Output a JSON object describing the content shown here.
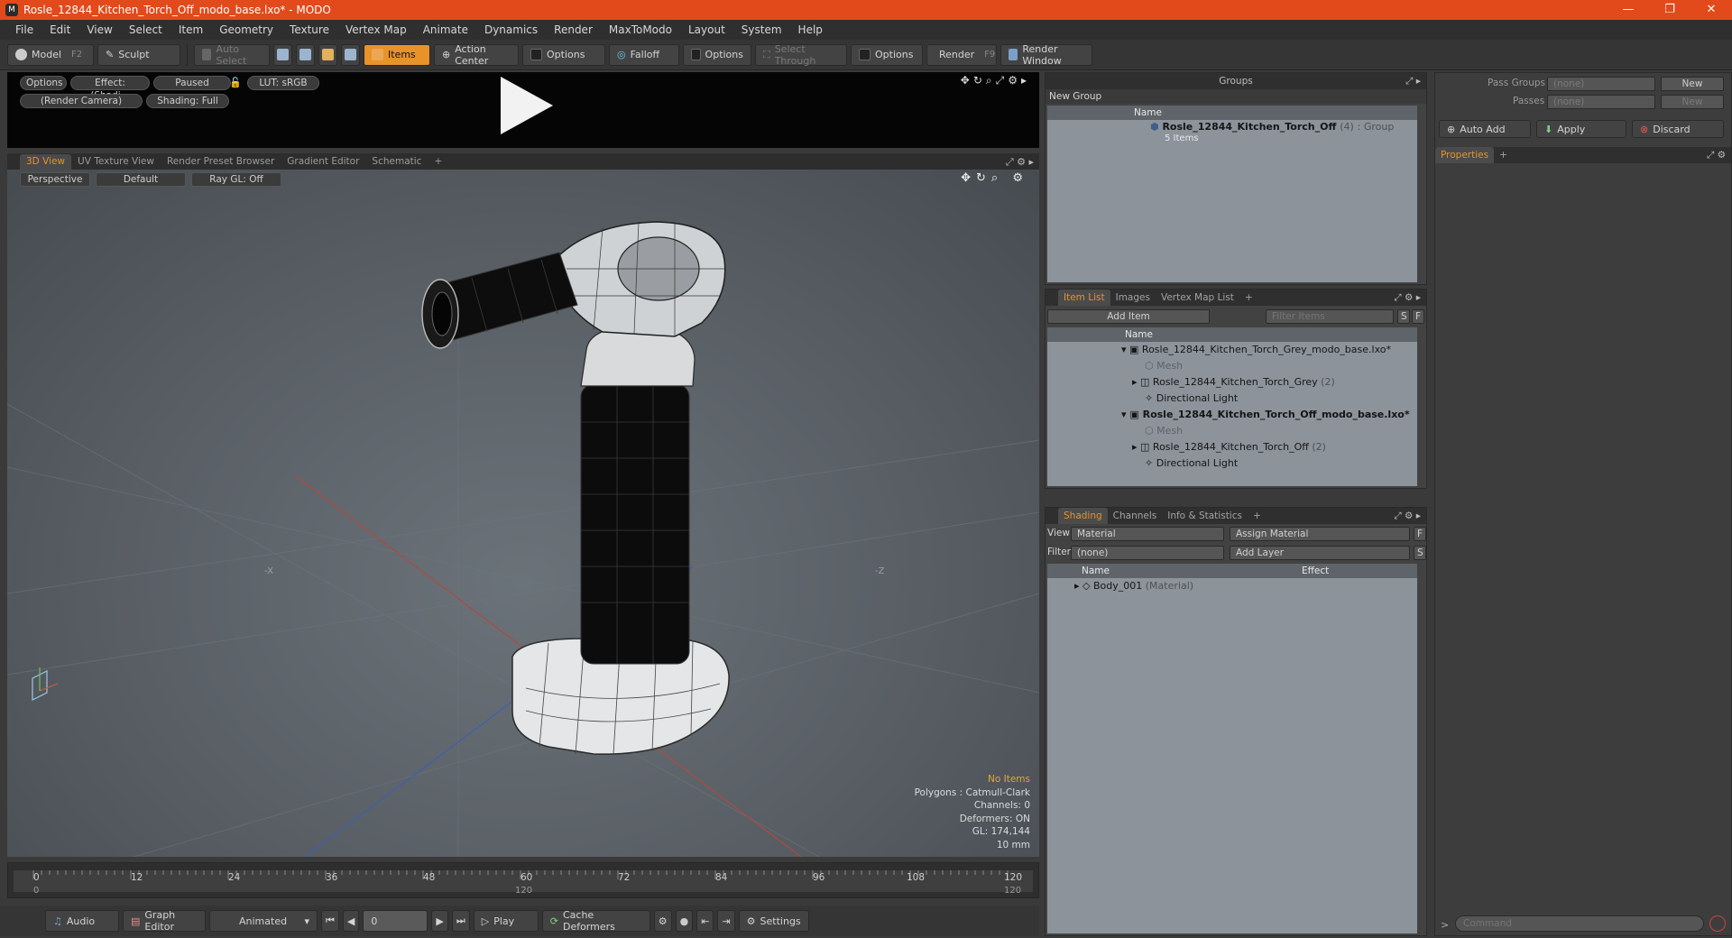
{
  "window": {
    "title": "Rosle_12844_Kitchen_Torch_Off_modo_base.lxo* - MODO",
    "app_icon": "modo-icon",
    "min": "—",
    "max": "❐",
    "close": "✕"
  },
  "menu": [
    "File",
    "Edit",
    "View",
    "Select",
    "Item",
    "Geometry",
    "Texture",
    "Vertex Map",
    "Animate",
    "Dynamics",
    "Render",
    "MaxToModo",
    "Layout",
    "System",
    "Help"
  ],
  "toolbar": {
    "model": "Model",
    "model_key": "F2",
    "sculpt": "Sculpt",
    "auto_select": "Auto Select",
    "items": "Items",
    "action_center": "Action Center",
    "options": "Options",
    "falloff": "Falloff",
    "select_through": "Select Through",
    "render": "Render",
    "render_key": "F9",
    "render_window": "Render Window"
  },
  "preview": {
    "options": "Options",
    "effect": "Effect: (Shadi...",
    "paused": "Paused",
    "lut": "LUT: sRGB",
    "camera": "(Render Camera)",
    "shading": "Shading: Full"
  },
  "view_tabs": [
    "3D View",
    "UV Texture View",
    "Render Preset Browser",
    "Gradient Editor",
    "Schematic",
    "+"
  ],
  "viewport": {
    "perspective": "Perspective",
    "default": "Default",
    "raygl": "Ray GL: Off",
    "info": {
      "no_items": "No Items",
      "polygons": "Polygons : Catmull-Clark",
      "channels": "Channels: 0",
      "deformers": "Deformers: ON",
      "gl": "GL: 174,144",
      "unit": "10 mm"
    },
    "axis_x": "-X",
    "axis_z": "-Z"
  },
  "timeline": {
    "ticks": [
      "0",
      "12",
      "24",
      "36",
      "48",
      "60",
      "72",
      "84",
      "96",
      "108",
      "120"
    ],
    "sub_ticks": [
      "0",
      "120",
      "120"
    ]
  },
  "bottom": {
    "audio": "Audio",
    "graph_editor": "Graph Editor",
    "animated": "Animated",
    "frame": "0",
    "play": "Play",
    "cache_deformers": "Cache Deformers",
    "settings": "Settings"
  },
  "groups": {
    "title": "Groups",
    "new_group": "New Group",
    "col_name": "Name",
    "item": {
      "name": "Rosle_12844_Kitchen_Torch_Off",
      "count": "(4)",
      "type": ": Group",
      "sub": "5 Items"
    }
  },
  "passes": {
    "pass_groups_label": "Pass Groups",
    "pass_groups_value": "(none)",
    "new1": "New",
    "passes_label": "Passes",
    "passes_value": "(none)",
    "new2": "New",
    "auto_add": "Auto Add",
    "apply": "Apply",
    "discard": "Discard",
    "properties": "Properties",
    "plus": "+"
  },
  "item_list": {
    "tabs": [
      "Item List",
      "Images",
      "Vertex Map List",
      "+"
    ],
    "add_item": "Add Item",
    "filter": "Filter Items",
    "s": "S",
    "f": "F",
    "col_name": "Name",
    "rows": [
      {
        "label": "Rosle_12844_Kitchen_Torch_Grey_modo_base.lxo*",
        "meta": ""
      },
      {
        "label": "Mesh",
        "meta": ""
      },
      {
        "label": "Rosle_12844_Kitchen_Torch_Grey",
        "meta": "(2)"
      },
      {
        "label": "Directional Light",
        "meta": ""
      },
      {
        "label": "Rosle_12844_Kitchen_Torch_Off_modo_base.lxo*",
        "meta": ""
      },
      {
        "label": "Mesh",
        "meta": ""
      },
      {
        "label": "Rosle_12844_Kitchen_Torch_Off",
        "meta": "(2)"
      },
      {
        "label": "Directional Light",
        "meta": ""
      }
    ]
  },
  "shading": {
    "tabs": [
      "Shading",
      "Channels",
      "Info & Statistics",
      "+"
    ],
    "view_label": "View",
    "view_value": "Material",
    "assign_material": "Assign Material",
    "f": "F",
    "filter_label": "Filter",
    "filter_value": "(none)",
    "add_layer": "Add Layer",
    "s": "S",
    "col_name": "Name",
    "col_effect": "Effect",
    "row": {
      "name": "Body_001",
      "meta": "(Material)"
    }
  },
  "command": {
    "placeholder": "Command",
    "prompt": ">"
  }
}
